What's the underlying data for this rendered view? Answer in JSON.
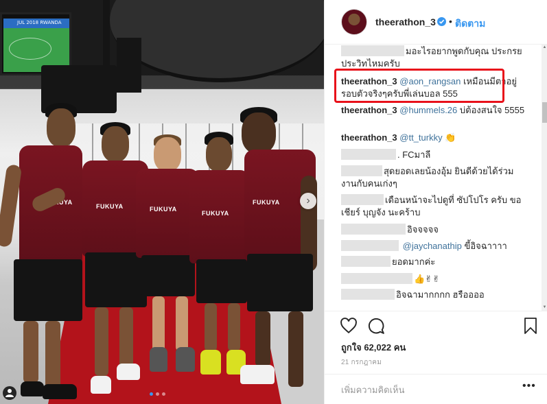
{
  "photo": {
    "tv_caption": "JUL 2018 RWANDA",
    "sponsor": "FUKUYA",
    "carousel_total": 3,
    "carousel_active": 1
  },
  "header": {
    "username": "theerathon_3",
    "separator": "•",
    "follow_label": "ติดตาม"
  },
  "comments": [
    {
      "author": "",
      "mention": "",
      "text": "มอะไรอยากพูดกับคุณ ประกรย ประวิทไหมครับ"
    },
    {
      "author": "theerathon_3",
      "mention": "@aon_rangsan",
      "text": "เหมือนมีตาอยู่รอบตัวจริงๆครับพี่เล่นบอล 555"
    },
    {
      "author": "theerathon_3",
      "mention": "@hummels.26",
      "text": "บ่ต้องสนใจ 5555"
    },
    {
      "author": "theerathon_3",
      "mention": "@tt_turkky",
      "text": "👏"
    },
    {
      "author": "",
      "mention": "",
      "text": ". FCมาลี"
    },
    {
      "author": "",
      "mention": "",
      "text": "สุดยอดเลยน้องอุ้ม ยินดีด้วยได้ร่วมงานกับคนเก่งๆ"
    },
    {
      "author": "",
      "mention": "",
      "text": "เดือนหน้าจะไปดูที่ ซัปโปโร ครับ ขอเชียร์ บุญจัง นะคร้าบ"
    },
    {
      "author": "",
      "mention": "",
      "text": "อิจจจจจ"
    },
    {
      "author": "",
      "mention": "@jaychanathip",
      "text": "ขี้อิจฉาาาา"
    },
    {
      "author": "",
      "mention": "",
      "text": "ยอดมากค่ะ"
    },
    {
      "author": "",
      "mention": "",
      "text": "👍✌✌"
    },
    {
      "author": "",
      "mention": "",
      "text": "อิจฉามากกกก ฮรืออออ"
    }
  ],
  "actions": {
    "like_icon": "heart-icon",
    "comment_icon": "comment-icon",
    "save_icon": "bookmark-icon"
  },
  "likes_text": "ถูกใจ 62,022 คน",
  "date_text": "21 กรกฎาคม",
  "comment_box": {
    "placeholder": "เพิ่มความคิดเห็น",
    "more_label": "•••"
  },
  "colors": {
    "accent": "#3897f0",
    "highlight": "#e8111a",
    "jersey": "#7a1521"
  }
}
